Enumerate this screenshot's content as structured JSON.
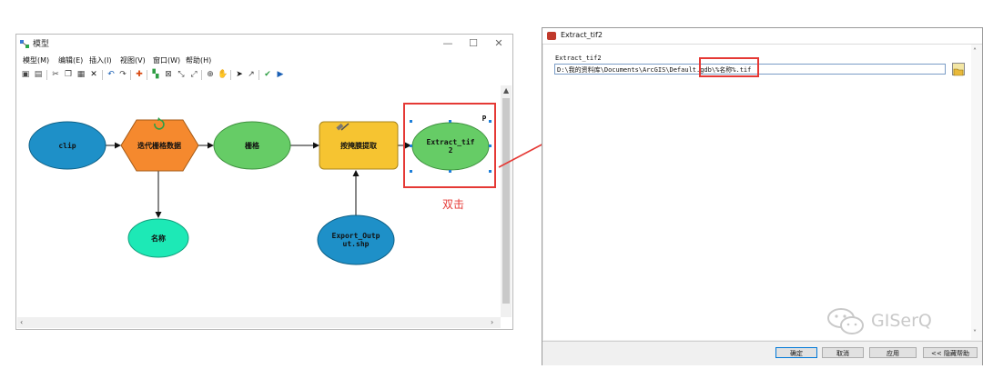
{
  "modelbuilder": {
    "title": "模型",
    "window_controls": [
      "—",
      "☐",
      "✕"
    ],
    "menu": [
      "模型(M)",
      "编辑(E)",
      "插入(I)",
      "视图(V)",
      "窗口(W)",
      "帮助(H)"
    ],
    "nodes": {
      "clip": "clip",
      "iterate": "迭代栅格数据",
      "raster": "栅格",
      "extract": "按掩膜提取",
      "extract_out_line1": "Extract_tif",
      "extract_out_line2": "2",
      "name": "名称",
      "export_line1": "Export_Outp",
      "export_line2": "ut.shp",
      "p_marker": "P"
    },
    "colors": {
      "blue_ellipse": "#1e90c8",
      "green_ellipse": "#66cc66",
      "orange_hex": "#f5892e",
      "yellow_tool": "#f6c431",
      "cyan_ellipse": "#1de9b6"
    }
  },
  "annotation": {
    "double_click": "双击"
  },
  "dialog": {
    "title": "Extract_tif2",
    "param_label": "Extract_tif2",
    "path_value": "D:\\我的资料库\\Documents\\ArcGIS\\Default.gdb\\%名称%.tif",
    "buttons": {
      "ok": "确定",
      "cancel": "取消",
      "apply": "应用",
      "help": "<< 隐藏帮助"
    }
  },
  "watermark": {
    "text": "GISerQ",
    "icon": "wechat-icon"
  }
}
